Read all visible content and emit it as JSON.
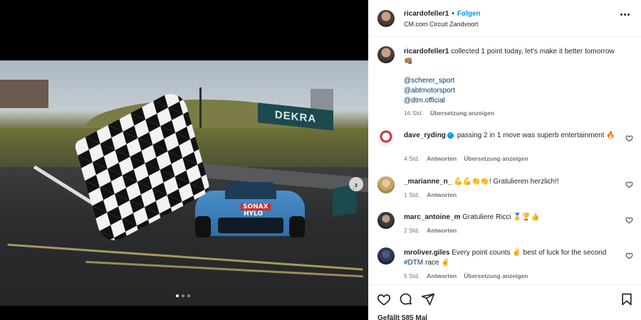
{
  "post": {
    "author": "ricardofeller1",
    "follow_label": "Folgen",
    "separator": "•",
    "location": "CM.com Circuit Zandvoort",
    "caption_author": "ricardofeller1",
    "caption_text": "collected 1 point today, let's make it better tomorrow 👊🏽",
    "mentions": [
      "@scherer_sport",
      "@abtmotorsport",
      "@dtm.official"
    ],
    "caption_time": "16 Std.",
    "caption_translate": "Übersetzung anzeigen",
    "likes": "Gefällt 585 Mal"
  },
  "photo": {
    "billboard_text": "DEKRA",
    "car_sponsor": "SONAX",
    "car_logo": "HYLO",
    "carousel_dots": 3,
    "active_dot": 0
  },
  "comments": [
    {
      "user": "dave_ryding",
      "verified": true,
      "text": "passing 2 in 1 move was superb entertainment 🔥",
      "time": "4 Std.",
      "reply": "Antworten",
      "translate": "Übersetzung anzeigen"
    },
    {
      "user": "_marianne_n_",
      "verified": false,
      "text": "💪💪👏👏! Gratulieren herzlich!!",
      "time": "1 Std.",
      "reply": "Antworten",
      "translate": ""
    },
    {
      "user": "marc_antoine_m",
      "verified": false,
      "text": "Gratuliere Ricci 🥇🏆👍",
      "time": "2 Std.",
      "reply": "Antworten",
      "translate": ""
    },
    {
      "user": "mroliver.giles",
      "verified": false,
      "text": "Every point counts ✌️ best of luck for the second",
      "hashtag": "#DTM",
      "text_after": "race ✌️",
      "time": "5 Std.",
      "reply": "Antworten",
      "translate": "Übersetzung anzeigen"
    }
  ],
  "icons": {
    "more": "more-options-icon",
    "next": "chevron-right-icon",
    "like": "heart-icon",
    "comment": "comment-icon",
    "share": "share-icon",
    "save": "bookmark-icon"
  },
  "colors": {
    "link": "#00376b",
    "follow": "#0095f6",
    "text": "#262626",
    "muted": "#737373"
  }
}
